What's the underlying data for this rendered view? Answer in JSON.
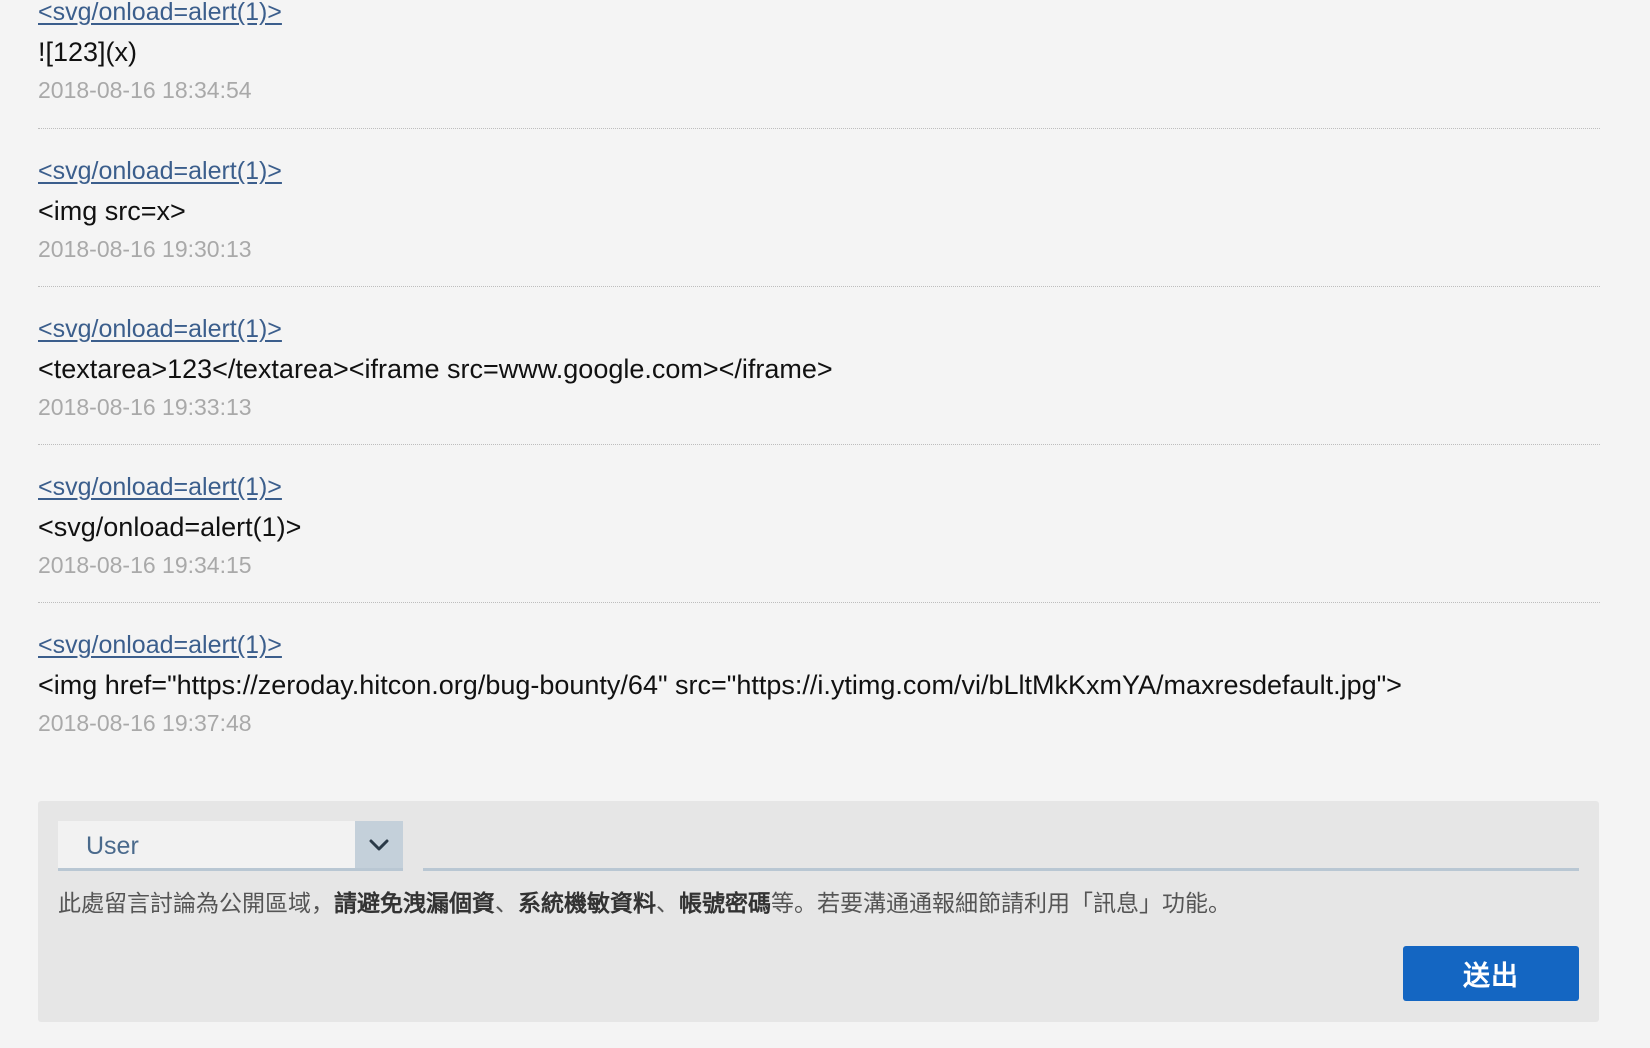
{
  "comments": [
    {
      "author": "<svg/onload=alert(1)>",
      "body": "![123](x)",
      "time": "2018-08-16 18:34:54"
    },
    {
      "author": "<svg/onload=alert(1)>",
      "body": "<img src=x>",
      "time": "2018-08-16 19:30:13"
    },
    {
      "author": "<svg/onload=alert(1)>",
      "body": "<textarea>123</textarea><iframe src=www.google.com></iframe>",
      "time": "2018-08-16 19:33:13"
    },
    {
      "author": "<svg/onload=alert(1)>",
      "body": "<svg/onload=alert(1)>",
      "time": "2018-08-16 19:34:15"
    },
    {
      "author": "<svg/onload=alert(1)>",
      "body": "<img href=\"https://zeroday.hitcon.org/bug-bounty/64\" src=\"https://i.ytimg.com/vi/bLltMkKxmYA/maxresdefault.jpg\">",
      "time": "2018-08-16 19:37:48"
    }
  ],
  "reply": {
    "role_selected": "User",
    "message_value": "",
    "notice_prefix": "此處留言討論為公開區域，",
    "notice_emphasis_1": "請避免洩漏個資",
    "notice_sep_1": "、",
    "notice_emphasis_2": "系統機敏資料",
    "notice_sep_2": "、",
    "notice_emphasis_3": "帳號密碼",
    "notice_suffix": "等。若要溝通通報細節請利用「訊息」功能。",
    "submit_label": "送出"
  },
  "icons": {
    "role_select_arrow": "chevron-down-icon"
  },
  "colors": {
    "page_background": "#f4f4f4",
    "link": "#3b5e8c",
    "timestamp": "#a9a9a9",
    "reply_box_background": "#e6e6e6",
    "select_arrow_background": "#c4d0da",
    "submit_button": "#1466c2"
  }
}
